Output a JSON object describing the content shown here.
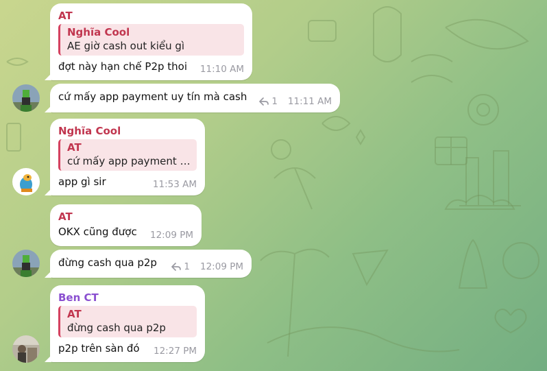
{
  "colors": {
    "name_at": "#c1364f",
    "name_nghia": "#c1364f",
    "name_ben": "#8a4fd0",
    "quote_bar": "#d4415f",
    "quote_bg": "#f9e4e7",
    "time": "#9a9aa2"
  },
  "messages": [
    {
      "sender": "AT",
      "quote_name": "Nghĩa Cool",
      "quote_text": "AE giờ cash out kiểu gì",
      "text": "đợt này hạn chế P2p thoi",
      "time": "11:10 AM"
    },
    {
      "text": "cứ mấy app payment uy tín mà cash",
      "forwards": "1",
      "time": "11:11 AM"
    },
    {
      "sender": "Nghĩa Cool",
      "quote_name": "AT",
      "quote_text": "cứ mấy app payment uy tín mà cash",
      "text": "app gì sir",
      "time": "11:53 AM"
    },
    {
      "sender": "AT",
      "text": "OKX cũng được",
      "time": "12:09 PM"
    },
    {
      "text": "đừng cash qua p2p",
      "forwards": "1",
      "time": "12:09 PM"
    },
    {
      "sender": "Ben CT",
      "quote_name": "AT",
      "quote_text": "đừng cash qua p2p",
      "text": "p2p trên sàn đó",
      "time": "12:27 PM"
    }
  ]
}
